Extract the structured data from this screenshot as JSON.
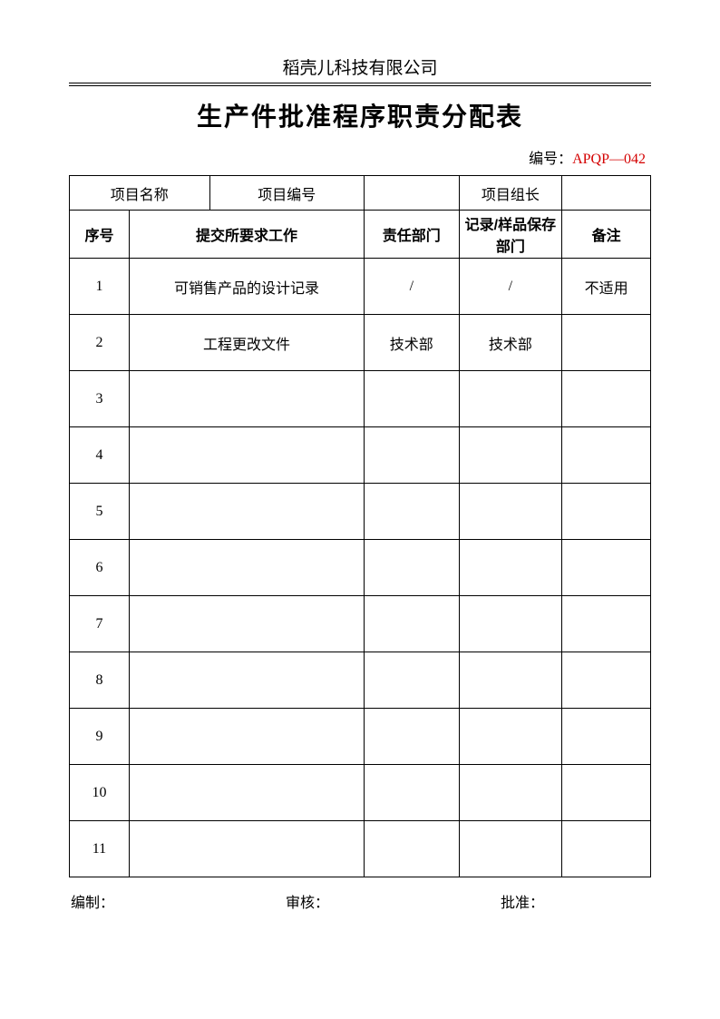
{
  "company": "稻壳儿科技有限公司",
  "title": "生产件批准程序职责分配表",
  "docno_label": "编号：",
  "docno_value": "APQP—042",
  "meta": {
    "project_name_label": "项目名称",
    "project_name_value": "",
    "project_code_label": "项目编号",
    "project_code_value": "",
    "leader_label": "项目组长",
    "leader_value": ""
  },
  "headers": {
    "seq": "序号",
    "work": "提交所要求工作",
    "dept": "责任部门",
    "record": "记录/样品保存部门",
    "remark": "备注"
  },
  "rows": [
    {
      "seq": "1",
      "work": "可销售产品的设计记录",
      "dept": "/",
      "record": "/",
      "remark": "不适用"
    },
    {
      "seq": "2",
      "work": "工程更改文件",
      "dept": "技术部",
      "record": "技术部",
      "remark": ""
    },
    {
      "seq": "3",
      "work": "",
      "dept": "",
      "record": "",
      "remark": ""
    },
    {
      "seq": "4",
      "work": "",
      "dept": "",
      "record": "",
      "remark": ""
    },
    {
      "seq": "5",
      "work": "",
      "dept": "",
      "record": "",
      "remark": ""
    },
    {
      "seq": "6",
      "work": "",
      "dept": "",
      "record": "",
      "remark": ""
    },
    {
      "seq": "7",
      "work": "",
      "dept": "",
      "record": "",
      "remark": ""
    },
    {
      "seq": "8",
      "work": "",
      "dept": "",
      "record": "",
      "remark": ""
    },
    {
      "seq": "9",
      "work": "",
      "dept": "",
      "record": "",
      "remark": ""
    },
    {
      "seq": "10",
      "work": "",
      "dept": "",
      "record": "",
      "remark": ""
    },
    {
      "seq": "11",
      "work": "",
      "dept": "",
      "record": "",
      "remark": ""
    }
  ],
  "footer": {
    "prepared": "编制：",
    "reviewed": "审核：",
    "approved": "批准："
  }
}
